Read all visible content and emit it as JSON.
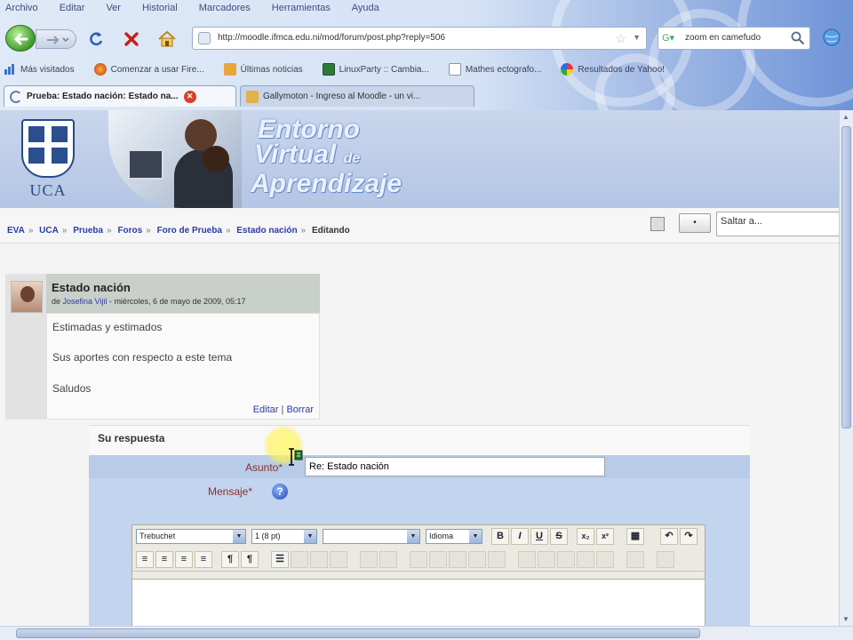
{
  "menubar": [
    "Archivo",
    "Editar",
    "Ver",
    "Historial",
    "Marcadores",
    "Herramientas",
    "Ayuda"
  ],
  "navbar": {
    "url": "http://moodle.ifmca.edu.ni/mod/forum/post.php?reply=506",
    "search_text": "zoom en camefudo"
  },
  "bookmarks": [
    "Más visitados",
    "Comenzar a usar Fire...",
    "Últimas noticias",
    "LinuxParty :: Cambia...",
    "Mathes ectografo...",
    "Resultados de Yahoo!"
  ],
  "tabs": [
    {
      "label": "Prueba: Estado nación: Estado na..."
    },
    {
      "label": "Gallymoton - Ingreso al Moodle - un vi..."
    }
  ],
  "banner": {
    "logo_text": "UCA",
    "title_line1": "Entorno",
    "title_line2": "Virtual",
    "title_de": "de",
    "title_line3": "Aprendizaje"
  },
  "breadcrumb": {
    "items": [
      "EVA",
      "UCA",
      "Prueba",
      "Foros",
      "Foro de Prueba",
      "Estado nación"
    ],
    "current": "Editando",
    "separator": "»"
  },
  "jump": {
    "button": "•",
    "select": "Saltar a..."
  },
  "post": {
    "subject": "Estado nación",
    "by_prefix": "de",
    "author": "Josefina Vijil",
    "date": "miércoles, 6 de mayo de 2009, 05:17",
    "lines": [
      "Estimadas y estimados",
      "Sus aportes con respecto a este tema",
      "Saludos"
    ],
    "edit": "Editar",
    "delete": "Borrar"
  },
  "reply": {
    "legend": "Su respuesta",
    "subject_label": "Asunto*",
    "subject_value": "Re: Estado nación",
    "message_label": "Mensaje*"
  },
  "editor": {
    "font": "Trebuchet",
    "size": "1 (8 pt)",
    "style": "",
    "lang": "Idioma"
  },
  "colors": {
    "link": "#2a3da0",
    "label_required": "#8a3030",
    "form_band": "#b8cbe8"
  }
}
